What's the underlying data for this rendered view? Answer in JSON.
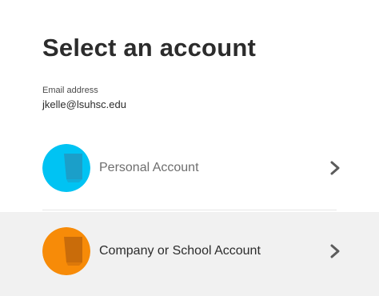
{
  "header": {
    "title": "Select an account"
  },
  "email": {
    "label": "Email address",
    "value": "jkelle@lsuhsc.edu"
  },
  "accounts": [
    {
      "label": "Personal Account",
      "icon": "personal-account-icon",
      "color": "#00c3f3",
      "shade": "#1b9fc9"
    },
    {
      "label": "Company or School Account",
      "icon": "company-account-icon",
      "color": "#f78b08",
      "shade": "#c96c0a"
    }
  ],
  "colors": {
    "selected_row_background": "#f1f1f1",
    "chevron": "#5c5c5c"
  }
}
